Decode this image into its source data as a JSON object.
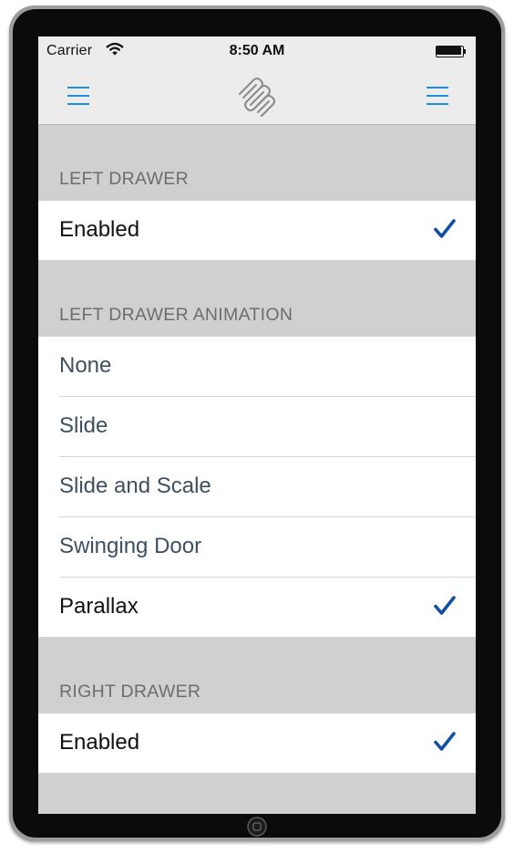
{
  "status_bar": {
    "carrier": "Carrier",
    "time": "8:50 AM"
  },
  "nav_bar": {
    "left_button_icon": "hamburger-menu-icon",
    "right_button_icon": "hamburger-menu-icon",
    "logo_icon": "paperclip-logo-icon",
    "accent_color": "#1a8fe3"
  },
  "sections": {
    "left_drawer": {
      "header": "LEFT DRAWER",
      "items": [
        {
          "label": "Enabled",
          "checked": true
        }
      ]
    },
    "left_drawer_animation": {
      "header": "LEFT DRAWER ANIMATION",
      "items": [
        {
          "label": "None",
          "checked": false
        },
        {
          "label": "Slide",
          "checked": false
        },
        {
          "label": "Slide and Scale",
          "checked": false
        },
        {
          "label": "Swinging Door",
          "checked": false
        },
        {
          "label": "Parallax",
          "checked": true
        }
      ]
    },
    "right_drawer": {
      "header": "RIGHT DRAWER",
      "items": [
        {
          "label": "Enabled",
          "checked": true
        }
      ]
    }
  },
  "colors": {
    "check": "#0f4fa8",
    "selected_text": "#111111",
    "unselected_text": "#3e4f5f",
    "section_background": "#d0d0d0"
  }
}
